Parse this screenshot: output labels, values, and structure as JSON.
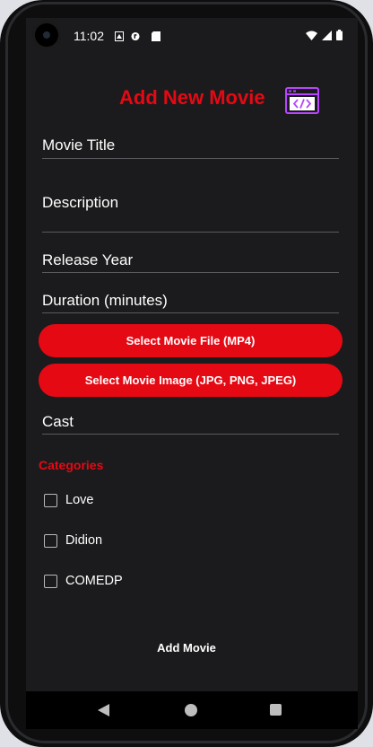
{
  "status_bar": {
    "time": "11:02"
  },
  "header": {
    "title": "Add New Movie",
    "icon": "code-window-icon"
  },
  "form": {
    "movie_title_placeholder": "Movie Title",
    "description_placeholder": "Description",
    "release_year_placeholder": "Release Year",
    "duration_placeholder": "Duration (minutes)",
    "select_file_label": "Select Movie File (MP4)",
    "select_image_label": "Select Movie Image (JPG, PNG, JPEG)",
    "cast_placeholder": "Cast",
    "categories_label": "Categories",
    "categories": [
      {
        "label": "Love",
        "checked": false
      },
      {
        "label": "Didion",
        "checked": false
      },
      {
        "label": "COMEDP",
        "checked": false
      }
    ],
    "submit_label": "Add Movie"
  },
  "colors": {
    "accent": "#e50914",
    "background": "#1b1b1d",
    "divider": "#5a5a5e"
  }
}
